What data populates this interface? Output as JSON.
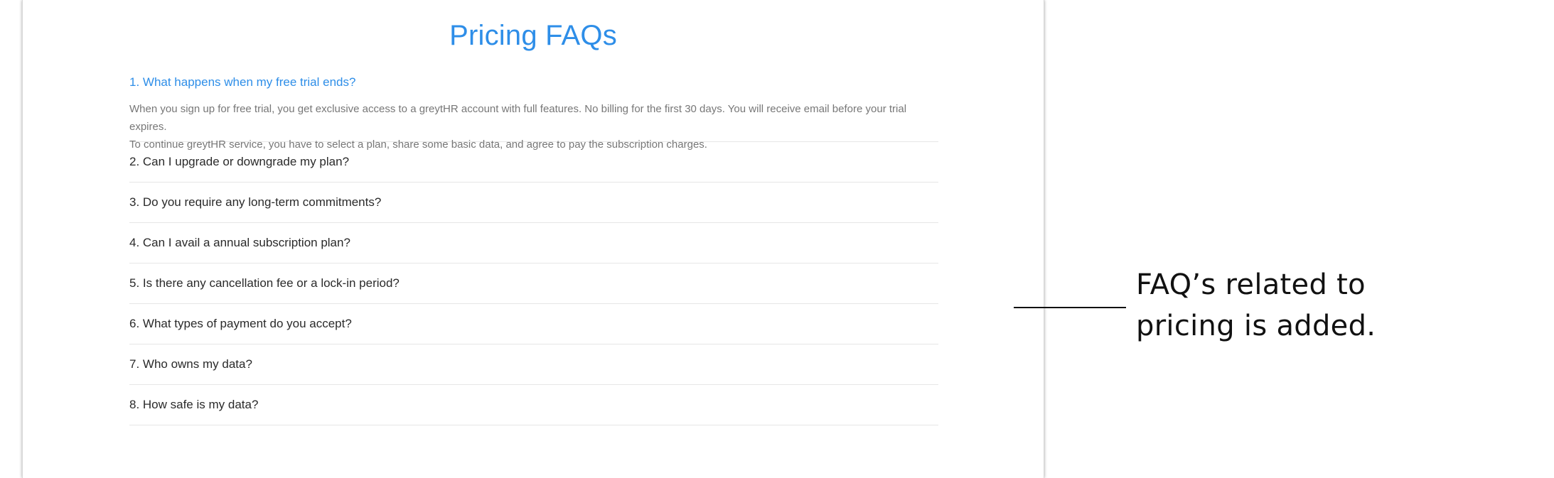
{
  "faq": {
    "title": "Pricing FAQs",
    "items": [
      {
        "question": "1. What happens when my free trial ends?",
        "answer_line1": "When you sign up for free trial, you get exclusive access to a greytHR account with full features. No billing for the first 30 days. You will receive email before your trial expires.",
        "answer_line2": "To continue greytHR service, you have to select a plan, share some basic data, and agree to pay the subscription charges."
      },
      {
        "question": "2. Can I upgrade or downgrade my plan?"
      },
      {
        "question": "3. Do you require any long-term commitments?"
      },
      {
        "question": "4. Can I avail a annual subscription plan?"
      },
      {
        "question": "5. Is there any cancellation fee or a lock-in period?"
      },
      {
        "question": "6. What types of payment do you accept?"
      },
      {
        "question": "7. Who owns my data?"
      },
      {
        "question": "8. How safe is my data?"
      }
    ]
  },
  "annotation": {
    "line1": "FAQ’s related to",
    "line2": "pricing is added."
  },
  "colors": {
    "accent": "#2e8ee8",
    "question_text": "#2a2a2a",
    "answer_text": "#777777",
    "divider": "#e6e6e6"
  }
}
